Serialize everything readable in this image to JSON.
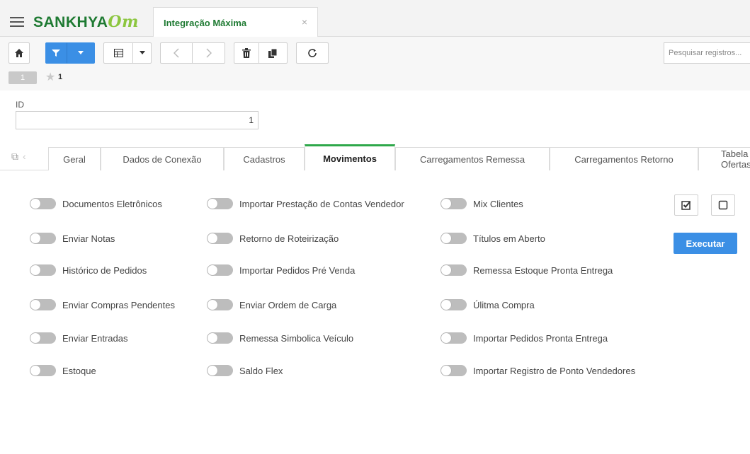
{
  "header": {
    "brand": "SANKHYA",
    "brand_suffix": "Om",
    "tab_title": "Integração Máxima",
    "tab_close": "×"
  },
  "toolbar": {
    "search_placeholder": "Pesquisar registros...",
    "page_number": "1",
    "favorites_count": "1"
  },
  "form": {
    "id_label": "ID",
    "id_value": "1"
  },
  "tabs": [
    {
      "label": "Geral"
    },
    {
      "label": "Dados de Conexão"
    },
    {
      "label": "Cadastros"
    },
    {
      "label": "Movimentos"
    },
    {
      "label": "Carregamentos Remessa"
    },
    {
      "label": "Carregamentos Retorno"
    },
    {
      "label": "Tabela de Ofertas"
    }
  ],
  "active_tab": "Movimentos",
  "options": {
    "col1": [
      {
        "label": "Documentos Eletrônicos",
        "on": false
      },
      {
        "label": "Enviar Notas",
        "on": false
      },
      {
        "label": "Histórico de Pedidos",
        "on": false
      },
      {
        "label": "Enviar Compras Pendentes",
        "on": false
      },
      {
        "label": "Enviar Entradas",
        "on": false
      },
      {
        "label": "Estoque",
        "on": false
      }
    ],
    "col2": [
      {
        "label": "Importar Prestação de Contas Vendedor",
        "on": false
      },
      {
        "label": "Retorno de Roteirização",
        "on": false
      },
      {
        "label": "Importar Pedidos Pré Venda",
        "on": false
      },
      {
        "label": "Enviar Ordem de Carga",
        "on": false
      },
      {
        "label": "Remessa Simbolica Veículo",
        "on": false
      },
      {
        "label": "Saldo Flex",
        "on": false
      }
    ],
    "col3": [
      {
        "label": "Mix Clientes",
        "on": false
      },
      {
        "label": "Títulos em Aberto",
        "on": false
      },
      {
        "label": "Remessa Estoque Pronta Entrega",
        "on": false
      },
      {
        "label": "Úlitma Compra",
        "on": false
      },
      {
        "label": "Importar Pedidos Pronta Entrega",
        "on": false
      },
      {
        "label": "Importar Registro de Ponto Vendedores",
        "on": false
      }
    ]
  },
  "actions": {
    "execute_label": "Executar"
  },
  "colors": {
    "brand_green": "#1e7a32",
    "accent_green": "#2ea84a",
    "primary_blue": "#3b8fe5",
    "toggle_off": "#bdbdbd"
  }
}
